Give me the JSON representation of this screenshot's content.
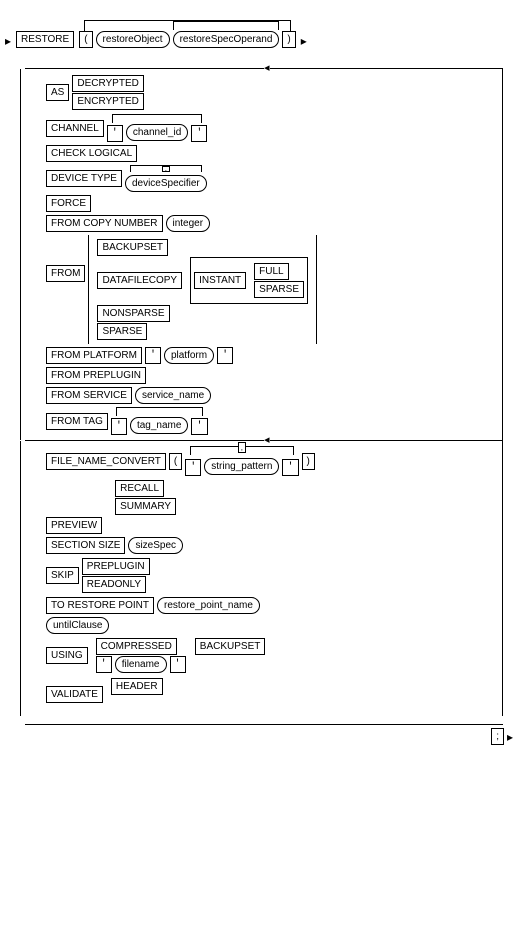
{
  "top": {
    "restore": "RESTORE",
    "lparen": "(",
    "restoreObject": "restoreObject",
    "restoreSpecOperand": "restoreSpecOperand",
    "rparen": ")"
  },
  "opts": {
    "as": "AS",
    "decrypted": "DECRYPTED",
    "encrypted": "ENCRYPTED",
    "channel": "CHANNEL",
    "channel_id": "channel_id",
    "check_logical": "CHECK LOGICAL",
    "device_type": "DEVICE TYPE",
    "deviceSpecifier": "deviceSpecifier",
    "force": "FORCE",
    "from_copy_number": "FROM COPY NUMBER",
    "integer": "integer",
    "from": "FROM",
    "backupset": "BACKUPSET",
    "datafilecopy": "DATAFILECOPY",
    "instant": "INSTANT",
    "full": "FULL",
    "sparse": "SPARSE",
    "nonsparse": "NONSPARSE",
    "from_platform": "FROM PLATFORM",
    "platform": "platform",
    "from_preplugin": "FROM PREPLUGIN",
    "from_service": "FROM SERVICE",
    "service_name": "service_name",
    "from_tag": "FROM TAG",
    "tag_name": "tag_name",
    "file_name_convert": "FILE_NAME_CONVERT",
    "string_pattern": "string_pattern",
    "preview": "PREVIEW",
    "recall": "RECALL",
    "summary": "SUMMARY",
    "section_size": "SECTION SIZE",
    "sizeSpec": "sizeSpec",
    "skip": "SKIP",
    "preplugin": "PREPLUGIN",
    "readonly": "READONLY",
    "to_restore_point": "TO RESTORE POINT",
    "restore_point_name": "restore_point_name",
    "untilClause": "untilClause",
    "using": "USING",
    "compressed": "COMPRESSED",
    "filename": "filename",
    "validate": "VALIDATE",
    "header": "HEADER",
    "comma": ",",
    "quote": "'",
    "semicolon": ";"
  }
}
